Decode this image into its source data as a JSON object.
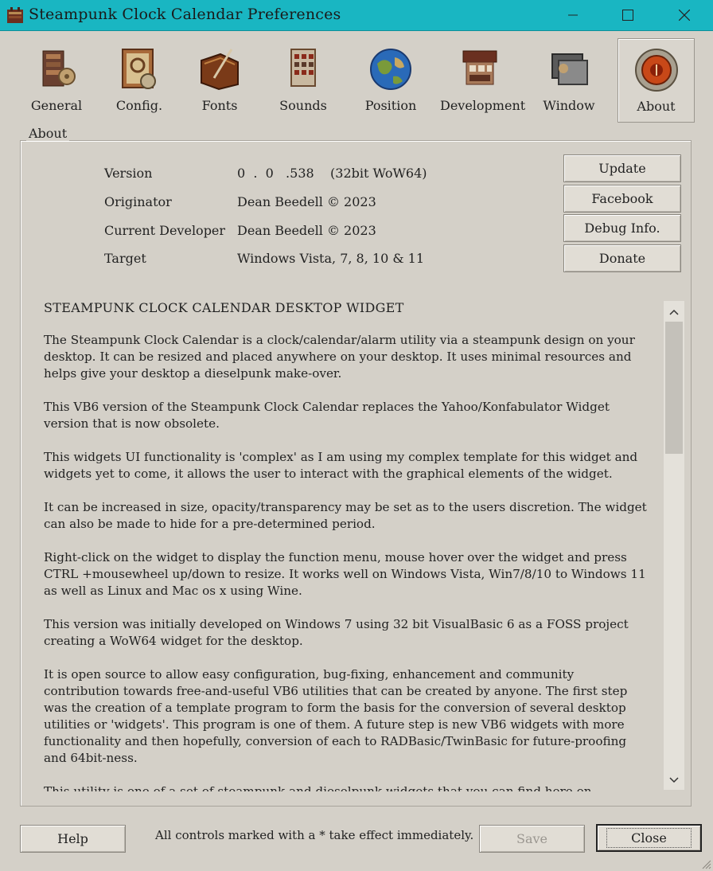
{
  "window": {
    "title": "Steampunk Clock Calendar Preferences"
  },
  "toolbar": {
    "items": [
      {
        "label": "General",
        "icon": "gears-machine-icon"
      },
      {
        "label": "Config.",
        "icon": "framed-gears-icon"
      },
      {
        "label": "Fonts",
        "icon": "book-quill-icon"
      },
      {
        "label": "Sounds",
        "icon": "keyboard-tower-icon"
      },
      {
        "label": "Position",
        "icon": "globe-icon"
      },
      {
        "label": "Development",
        "icon": "workbench-icon"
      },
      {
        "label": "Window",
        "icon": "window-panes-icon"
      },
      {
        "label": "About",
        "icon": "brass-gauge-icon"
      }
    ],
    "active": "About"
  },
  "about": {
    "group_title": "About",
    "fields": [
      {
        "label": "Version",
        "value": "0  .  0   .538    (32bit WoW64)"
      },
      {
        "label": "Originator",
        "value": "Dean Beedell © 2023"
      },
      {
        "label": "Current Developer",
        "value": "Dean Beedell © 2023"
      },
      {
        "label": "Target",
        "value": "Windows Vista, 7, 8, 10  & 11"
      }
    ],
    "buttons": {
      "update": "Update",
      "facebook": "Facebook",
      "debug": "Debug Info.",
      "donate": "Donate"
    },
    "text": {
      "heading": "STEAMPUNK CLOCK CALENDAR DESKTOP WIDGET",
      "paragraphs": [
        "The Steampunk Clock Calendar is a clock/calendar/alarm utility via a steampunk design on your desktop. It can be resized and placed anywhere on your desktop. It uses minimal resources and helps give your desktop a dieselpunk make-over.",
        "This VB6 version of the Steampunk Clock Calendar replaces the Yahoo/Konfabulator Widget version that is now obsolete.",
        "This widgets UI functionality is 'complex' as I am using my complex template for this widget and widgets yet to come, it allows the user to interact with the graphical elements of the widget.",
        "It can be increased in size, opacity/transparency may be set as to the users discretion. The widget can also be made to hide for a pre-determined period.",
        "Right-click on the widget to display the function menu, mouse hover over the widget and press CTRL +mousewheel up/down to resize. It works well on Windows Vista, Win7/8/10 to Windows 11 as well as Linux and Mac os x using Wine.",
        "This version was initially developed on Windows 7 using 32 bit VisualBasic 6 as a FOSS project creating a WoW64 widget for the desktop.",
        "It is open source to allow easy configuration, bug-fixing, enhancement and community contribution towards free-and-useful VB6 utilities that can be created by anyone. The first step was the creation of a template program to form the basis for the conversion of several desktop utilities or 'widgets'. This program is one of them. A future step is new VB6 widgets with more functionality and then hopefully, conversion of each to RADBasic/TwinBasic for future-proofing and 64bit-ness.",
        "This utility is one of a set of steampunk and dieselpunk widgets that you can find here on Deviantart:"
      ]
    }
  },
  "footer": {
    "help": "Help",
    "hint": "All controls marked with a * take effect immediately.",
    "save": "Save",
    "close": "Close"
  },
  "colors": {
    "titlebar": "#19b6c2",
    "background": "#d4d0c8"
  }
}
